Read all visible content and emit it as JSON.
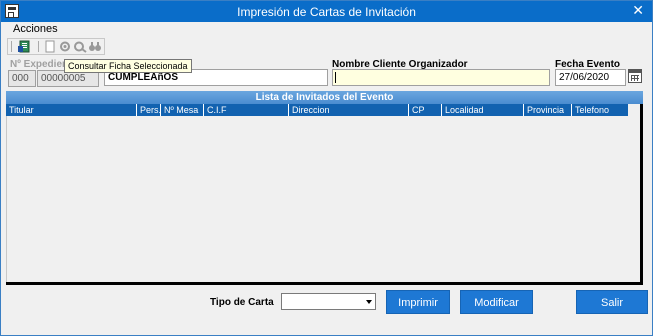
{
  "window": {
    "title": "Impresión de Cartas de Invitación",
    "close_glyph": "✕"
  },
  "menu": {
    "acciones": "Acciones"
  },
  "toolbar": {
    "icons": [
      "report-icon",
      "new-doc-icon",
      "gear-icon",
      "gear2-icon",
      "binoculars-icon"
    ]
  },
  "tooltip": "Consultar Ficha Seleccionada",
  "expediente": {
    "label": "Nº Expedient",
    "code": "000",
    "number": "00000005",
    "description": "CUMPLEAñOS"
  },
  "cliente": {
    "label": "Nombre Cliente Organizador",
    "value": ""
  },
  "fecha": {
    "label": "Fecha Evento",
    "value": "27/06/2020"
  },
  "grid": {
    "caption": "Lista de Invitados del Evento",
    "columns": [
      "Titular",
      "Pers.",
      "Nº Mesa",
      "C.I.F",
      "Direccion",
      "CP",
      "Localidad",
      "Provincia",
      "Telefono"
    ],
    "rows": []
  },
  "tipo_carta": {
    "label": "Tipo de Carta",
    "value": ""
  },
  "buttons": {
    "imprimir": "Imprimir",
    "modificar": "Modificar",
    "salir": "Salir"
  },
  "colors": {
    "titlebar": "#0a6dc9",
    "grid_header": "#1262b0",
    "button": "#1e78d4",
    "highlight_field": "#ffffe0"
  }
}
